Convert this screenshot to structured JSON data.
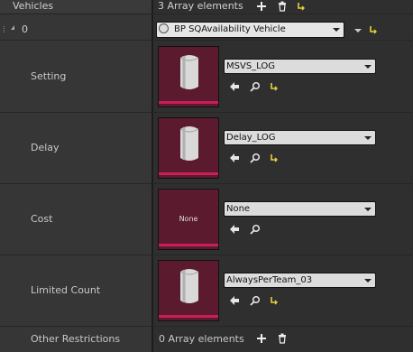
{
  "header": {
    "label": "Vehicles",
    "array_count": "3 Array elements"
  },
  "element": {
    "index": "0",
    "class_value": "BP SQAvailability Vehicle"
  },
  "properties": [
    {
      "label": "Setting",
      "value": "MSVS_LOG",
      "thumb_text": "",
      "has_reset": true
    },
    {
      "label": "Delay",
      "value": "Delay_LOG",
      "thumb_text": "",
      "has_reset": true
    },
    {
      "label": "Cost",
      "value": "None",
      "thumb_text": "None",
      "has_reset": false
    },
    {
      "label": "Limited Count",
      "value": "AlwaysPerTeam_03",
      "thumb_text": "",
      "has_reset": true
    }
  ],
  "other_restrictions": {
    "label": "Other Restrictions",
    "array_count": "0 Array elements"
  },
  "colors": {
    "thumb_bg": "#5c1a2e",
    "thumb_bar": "#c81e5a",
    "reset_icon": "#e6d23a"
  }
}
